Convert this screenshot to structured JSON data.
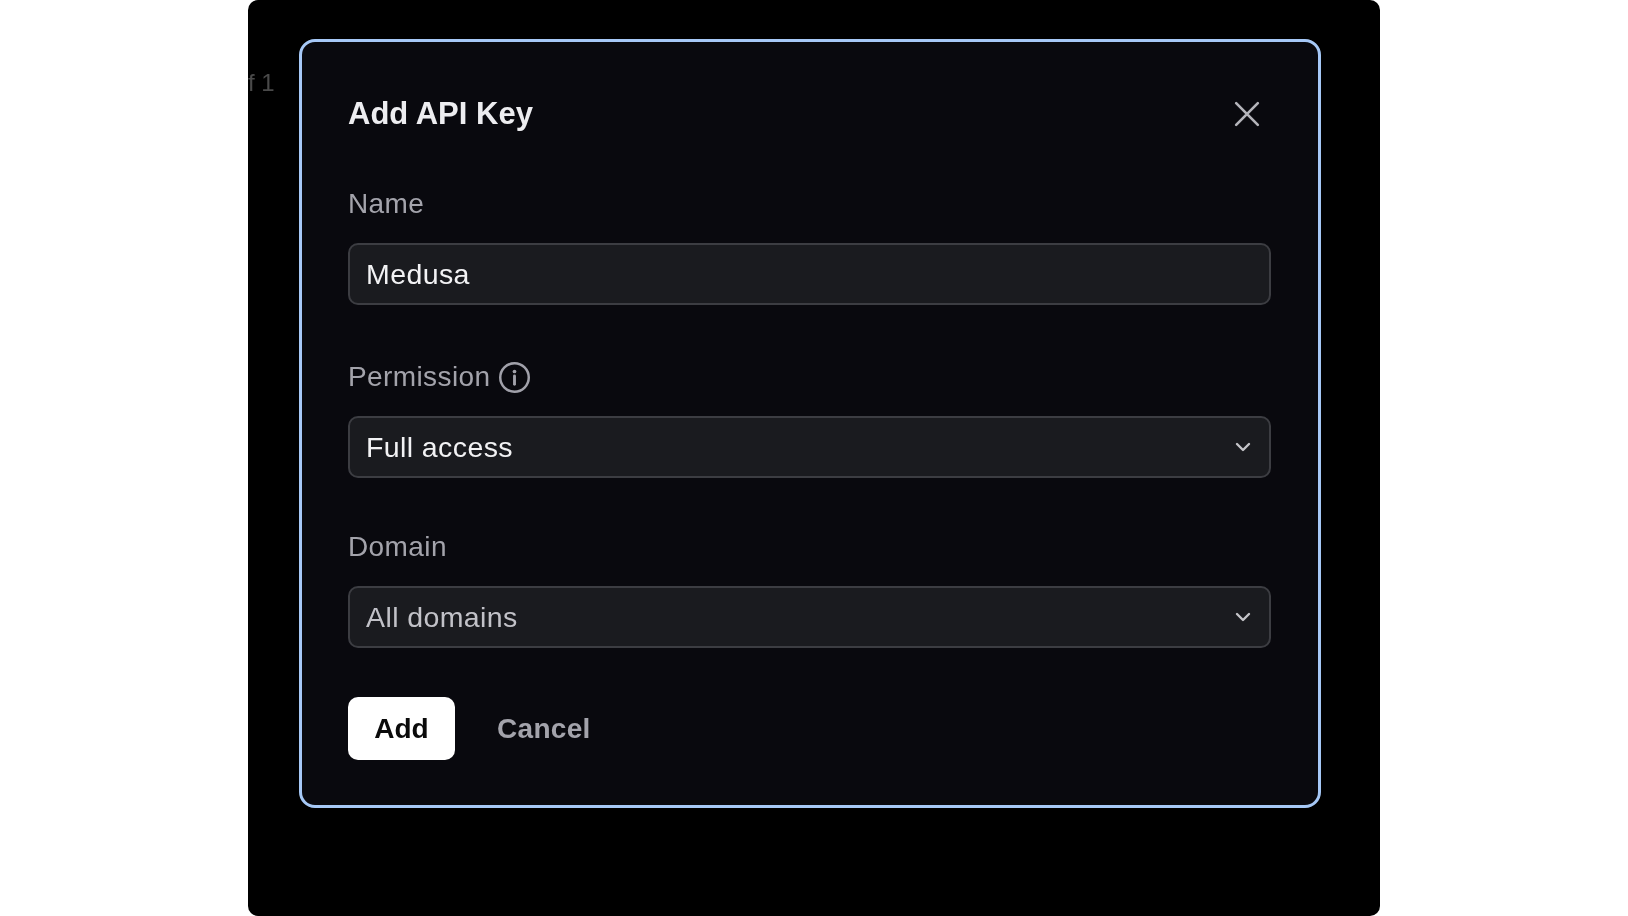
{
  "background_text": "f 1",
  "dialog": {
    "title": "Add API Key",
    "fields": [
      {
        "kind": "text",
        "label": "Name",
        "has_info": false,
        "value": "Medusa",
        "disabled": false
      },
      {
        "kind": "select",
        "label": "Permission",
        "has_info": true,
        "value": "Full access",
        "disabled": false
      },
      {
        "kind": "select",
        "label": "Domain",
        "has_info": false,
        "value": "All domains",
        "disabled": true
      }
    ],
    "buttons": [
      {
        "kind": "primary",
        "label": "Add"
      },
      {
        "kind": "secondary",
        "label": "Cancel"
      }
    ]
  }
}
